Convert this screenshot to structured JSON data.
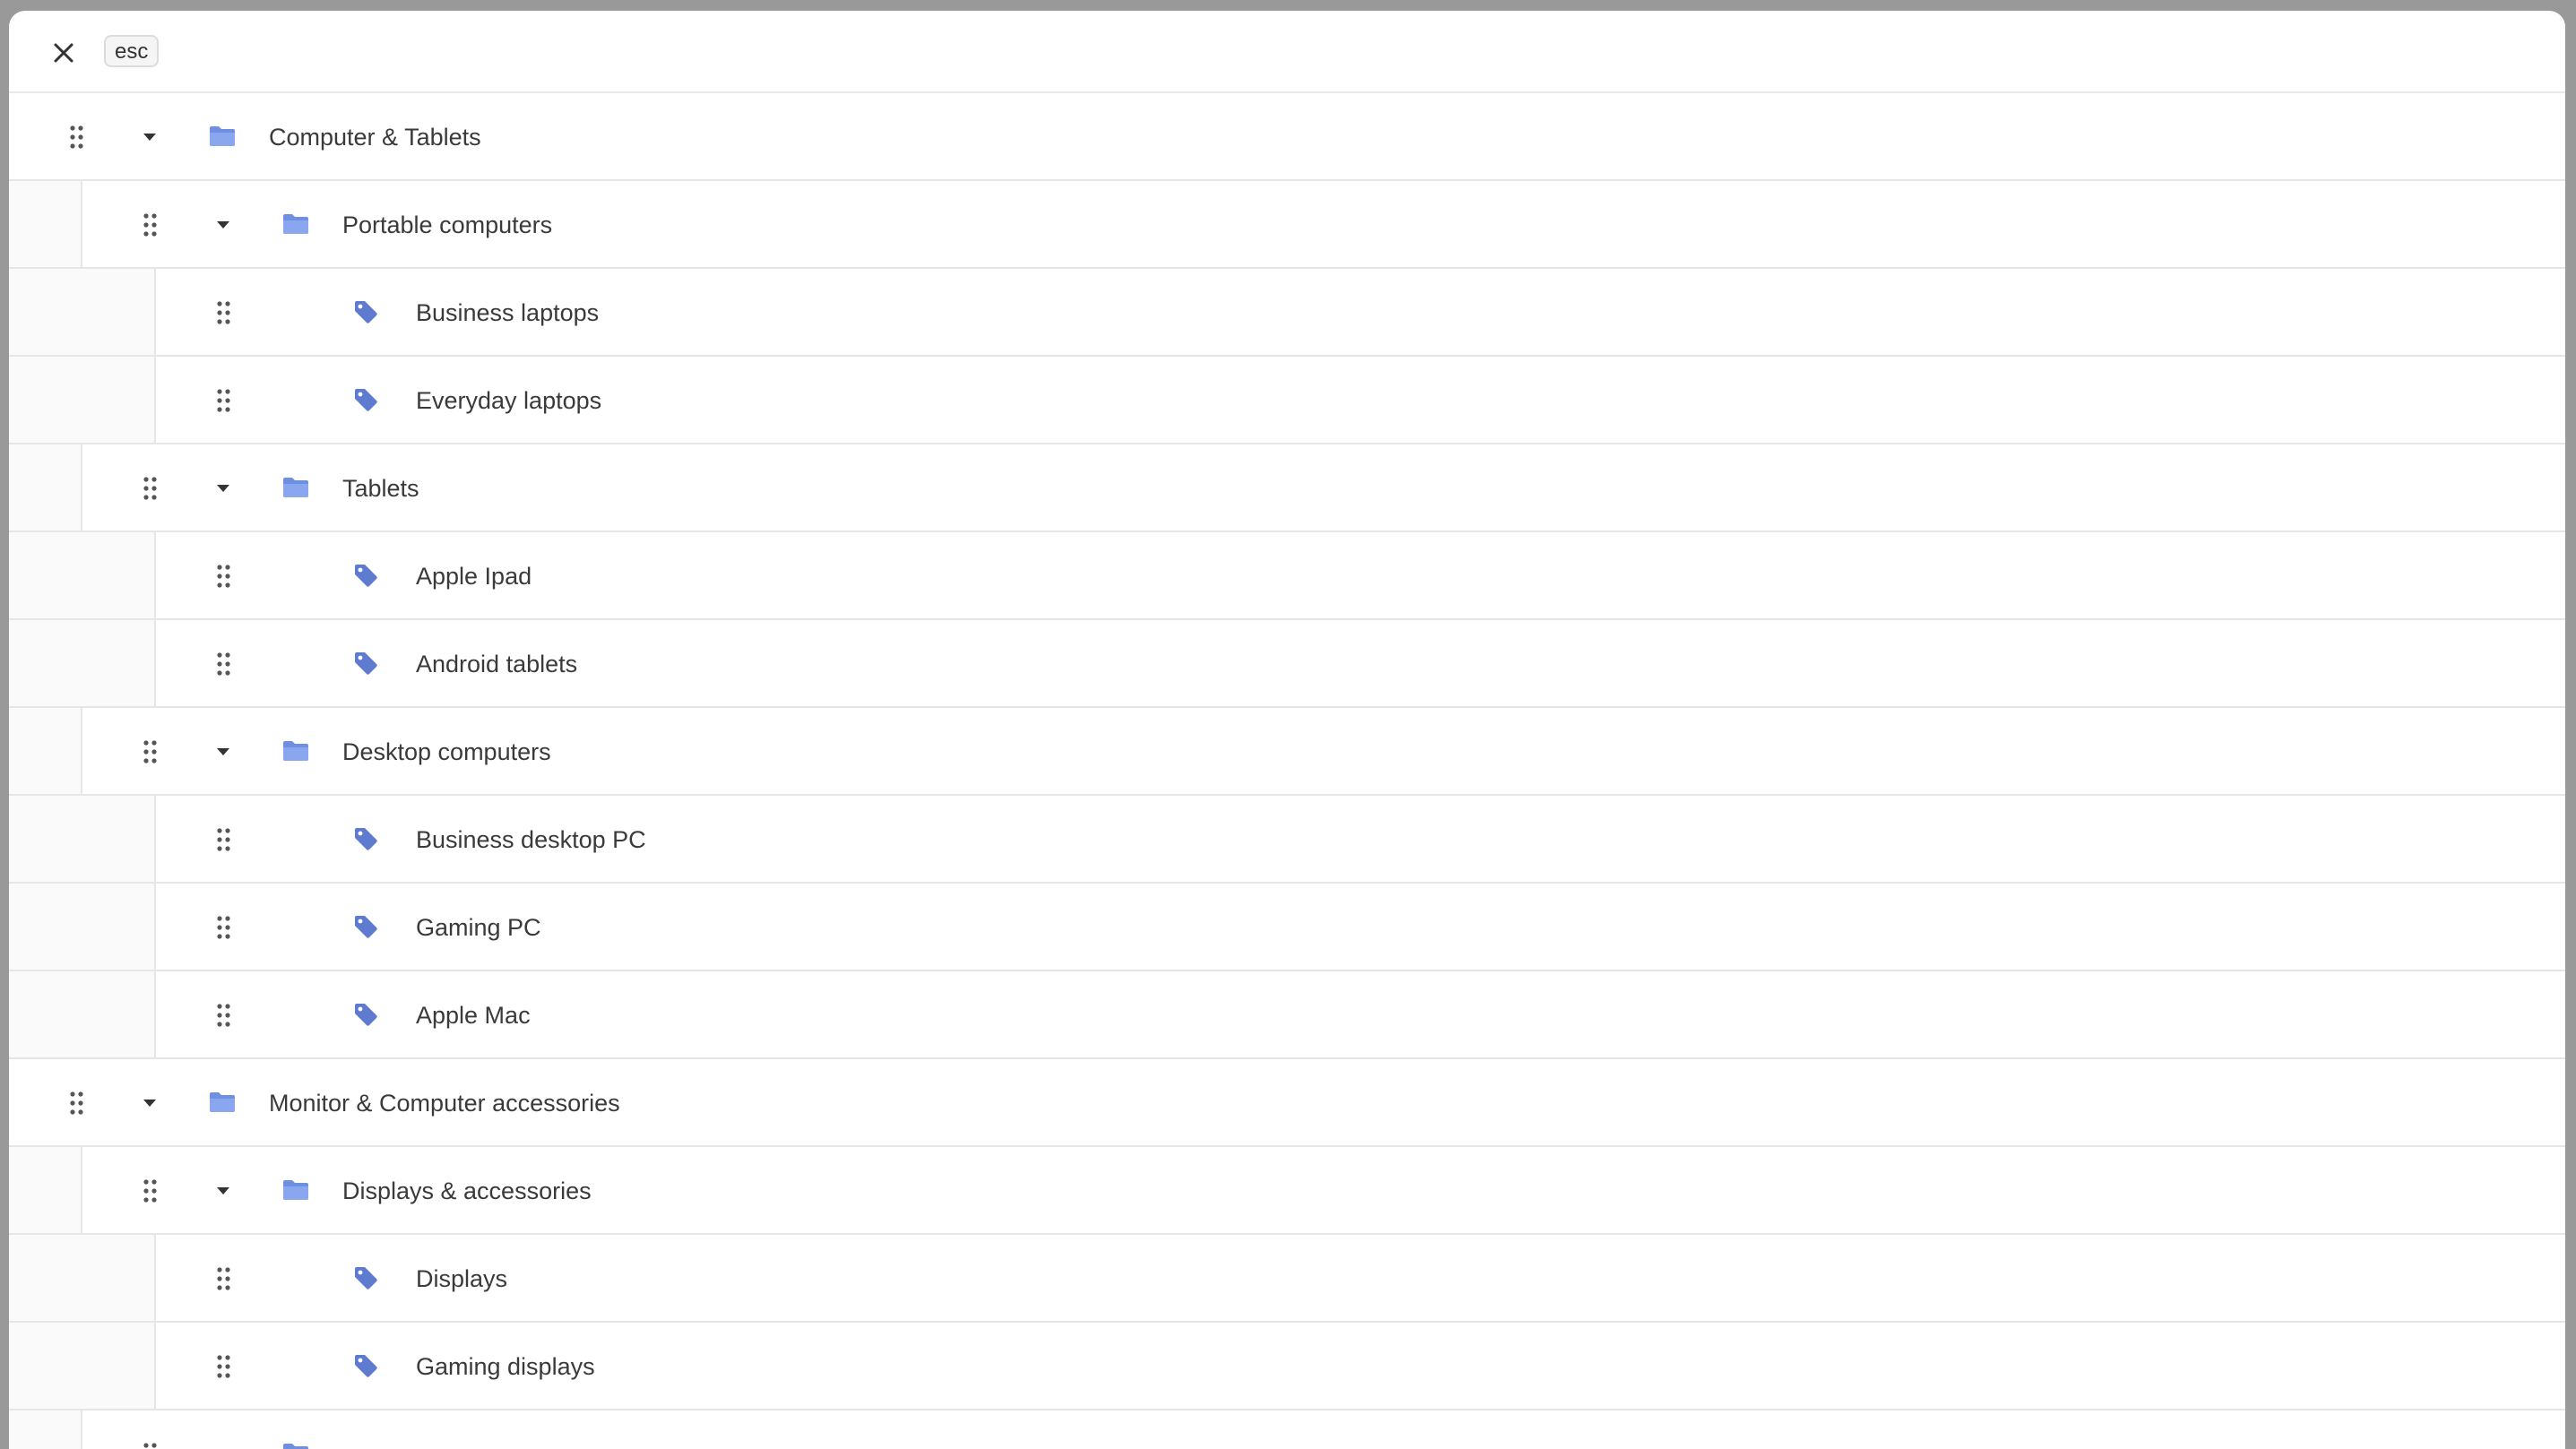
{
  "header": {
    "close_icon": "close-icon",
    "esc_label": "esc"
  },
  "colors": {
    "folder": "#6f8fe0",
    "tag": "#5f7bd0",
    "text": "#3a3a3a",
    "border": "#e6e6e6"
  },
  "tree": [
    {
      "level": 0,
      "type": "folder",
      "label": "Computer & Tablets",
      "expanded": true
    },
    {
      "level": 1,
      "type": "folder",
      "label": "Portable computers",
      "expanded": true
    },
    {
      "level": 2,
      "type": "tag",
      "label": "Business laptops"
    },
    {
      "level": 2,
      "type": "tag",
      "label": "Everyday laptops"
    },
    {
      "level": 1,
      "type": "folder",
      "label": "Tablets",
      "expanded": true
    },
    {
      "level": 2,
      "type": "tag",
      "label": "Apple Ipad"
    },
    {
      "level": 2,
      "type": "tag",
      "label": "Android tablets"
    },
    {
      "level": 1,
      "type": "folder",
      "label": "Desktop computers",
      "expanded": true
    },
    {
      "level": 2,
      "type": "tag",
      "label": "Business desktop PC"
    },
    {
      "level": 2,
      "type": "tag",
      "label": "Gaming PC"
    },
    {
      "level": 2,
      "type": "tag",
      "label": "Apple Mac"
    },
    {
      "level": 0,
      "type": "folder",
      "label": "Monitor & Computer accessories",
      "expanded": true
    },
    {
      "level": 1,
      "type": "folder",
      "label": "Displays & accessories",
      "expanded": true
    },
    {
      "level": 2,
      "type": "tag",
      "label": "Displays"
    },
    {
      "level": 2,
      "type": "tag",
      "label": "Gaming displays"
    },
    {
      "level": 1,
      "type": "folder",
      "label": "",
      "expanded": true
    }
  ]
}
